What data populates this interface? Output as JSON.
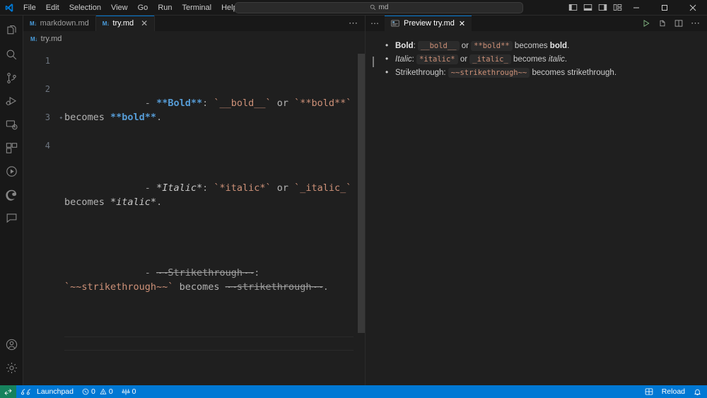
{
  "titlebar": {
    "logo_icon": "vscode-logo-icon",
    "menus": [
      "File",
      "Edit",
      "Selection",
      "View",
      "Go",
      "Run",
      "Terminal",
      "Help"
    ],
    "nav_back_icon": "arrow-left-icon",
    "nav_forward_icon": "arrow-right-icon",
    "quick_input": {
      "value": "md",
      "placeholder": "Search",
      "icon": "search-icon"
    },
    "layout_icons": [
      "toggle-primary-sidebar-icon",
      "toggle-panel-icon",
      "toggle-secondary-sidebar-icon",
      "customize-layout-icon"
    ],
    "window_controls": [
      "minimize-icon",
      "maximize-icon",
      "close-icon"
    ]
  },
  "activitybar": {
    "items": [
      {
        "name": "explorer",
        "icon": "files-icon"
      },
      {
        "name": "search",
        "icon": "search-icon"
      },
      {
        "name": "source-control",
        "icon": "source-control-icon"
      },
      {
        "name": "run-and-debug",
        "icon": "run-debug-icon"
      },
      {
        "name": "remote-explorer",
        "icon": "remote-explorer-icon"
      },
      {
        "name": "extensions",
        "icon": "extensions-icon"
      },
      {
        "name": "testing",
        "icon": "beaker-play-icon"
      },
      {
        "name": "browser-preview",
        "icon": "edge-browser-icon"
      },
      {
        "name": "chat",
        "icon": "comment-icon"
      }
    ],
    "bottom_items": [
      {
        "name": "accounts",
        "icon": "account-icon"
      },
      {
        "name": "manage-settings",
        "icon": "gear-icon"
      }
    ]
  },
  "editor": {
    "tabs": [
      {
        "label": "markdown.md",
        "icon": "markdown-file-icon",
        "active": false,
        "closable": false
      },
      {
        "label": "try.md",
        "icon": "markdown-file-icon",
        "active": true,
        "closable": true
      }
    ],
    "tabbar_more_icon": "more-actions-icon",
    "breadcrumb": {
      "icon": "markdown-file-icon",
      "label": "try.md"
    },
    "line_numbers": [
      "1",
      "2",
      "3",
      "4"
    ],
    "sparkle_icon": "sparkle-suggestion-icon",
    "lines": [
      {
        "number": "1",
        "tokens": [
          {
            "t": "- ",
            "c": "dash"
          },
          {
            "t": "**Bold**",
            "c": "bold"
          },
          {
            "t": ": ",
            "c": "punct"
          },
          {
            "t": "`__bold__`",
            "c": "code"
          },
          {
            "t": " or ",
            "c": "plain"
          },
          {
            "t": "`**bold**`",
            "c": "code"
          },
          {
            "t": " becomes ",
            "c": "plain"
          },
          {
            "t": "**bold**",
            "c": "bold"
          },
          {
            "t": ".",
            "c": "punct"
          }
        ]
      },
      {
        "number": "2",
        "tokens": [
          {
            "t": "- ",
            "c": "dash"
          },
          {
            "t": "*Italic*",
            "c": "italic"
          },
          {
            "t": ": ",
            "c": "punct"
          },
          {
            "t": "`*italic*`",
            "c": "code"
          },
          {
            "t": " or ",
            "c": "plain"
          },
          {
            "t": "`_italic_`",
            "c": "code"
          },
          {
            "t": " becomes ",
            "c": "plain"
          },
          {
            "t": "*italic*",
            "c": "italic"
          },
          {
            "t": ".",
            "c": "punct"
          }
        ]
      },
      {
        "number": "3",
        "tokens": [
          {
            "t": "- ",
            "c": "dash"
          },
          {
            "t": "~~Strikethrough~~",
            "c": "strike"
          },
          {
            "t": ": ",
            "c": "punct"
          },
          {
            "t": "`~~strikethrough~~`",
            "c": "code"
          },
          {
            "t": " becomes ",
            "c": "plain"
          },
          {
            "t": "~~strikethrough~~",
            "c": "strike"
          },
          {
            "t": ".",
            "c": "punct"
          }
        ]
      },
      {
        "number": "4",
        "tokens": []
      }
    ]
  },
  "preview": {
    "tab": {
      "label": "Preview try.md",
      "icon": "preview-icon",
      "close_icon": "close-icon"
    },
    "left_ellipsis_icon": "more-actions-icon",
    "actions": [
      "run-icon",
      "open-preview-to-side-icon",
      "split-editor-icon",
      "more-actions-icon"
    ],
    "items": [
      {
        "parts": [
          {
            "t": "Bold",
            "s": "bold"
          },
          {
            "t": ": ",
            "s": "plain"
          },
          {
            "t": "__bold__",
            "s": "code"
          },
          {
            "t": " or ",
            "s": "plain"
          },
          {
            "t": "**bold**",
            "s": "code"
          },
          {
            "t": " becomes ",
            "s": "plain"
          },
          {
            "t": "bold",
            "s": "bold"
          },
          {
            "t": ".",
            "s": "plain"
          }
        ]
      },
      {
        "parts": [
          {
            "t": "Italic",
            "s": "italic"
          },
          {
            "t": ": ",
            "s": "plain"
          },
          {
            "t": "*italic*",
            "s": "code"
          },
          {
            "t": " or ",
            "s": "plain"
          },
          {
            "t": "_italic_",
            "s": "code"
          },
          {
            "t": " becomes ",
            "s": "plain"
          },
          {
            "t": "italic",
            "s": "italic"
          },
          {
            "t": ".",
            "s": "plain"
          }
        ]
      },
      {
        "parts": [
          {
            "t": "Strikethrough",
            "s": "plain"
          },
          {
            "t": ": ",
            "s": "plain"
          },
          {
            "t": "~~strikethrough~~",
            "s": "code"
          },
          {
            "t": " becomes ",
            "s": "plain"
          },
          {
            "t": "strikethrough",
            "s": "plain"
          },
          {
            "t": ".",
            "s": "plain"
          }
        ]
      }
    ]
  },
  "statusbar": {
    "remote": {
      "icon": "remote-indicator-icon",
      "label": ""
    },
    "launchpad": {
      "icon": "launchpad-icon",
      "label": "Launchpad"
    },
    "problems": {
      "error_icon": "error-icon",
      "errors": "0",
      "warning_icon": "warning-icon",
      "warnings": "0"
    },
    "ports": {
      "icon": "ports-icon",
      "count": "0"
    },
    "right": [
      {
        "name": "extension-host",
        "icon": "extensions-status-icon",
        "label": ""
      },
      {
        "name": "reload",
        "icon": "",
        "label": "Reload"
      },
      {
        "name": "notifications",
        "icon": "bell-icon",
        "label": ""
      }
    ]
  },
  "colors": {
    "accent": "#0078d4",
    "remote_green": "#16825d",
    "titlebar_bg": "#181818",
    "editor_bg": "#1f1f1f",
    "bold_token": "#569cd6",
    "code_token": "#ce9178"
  }
}
